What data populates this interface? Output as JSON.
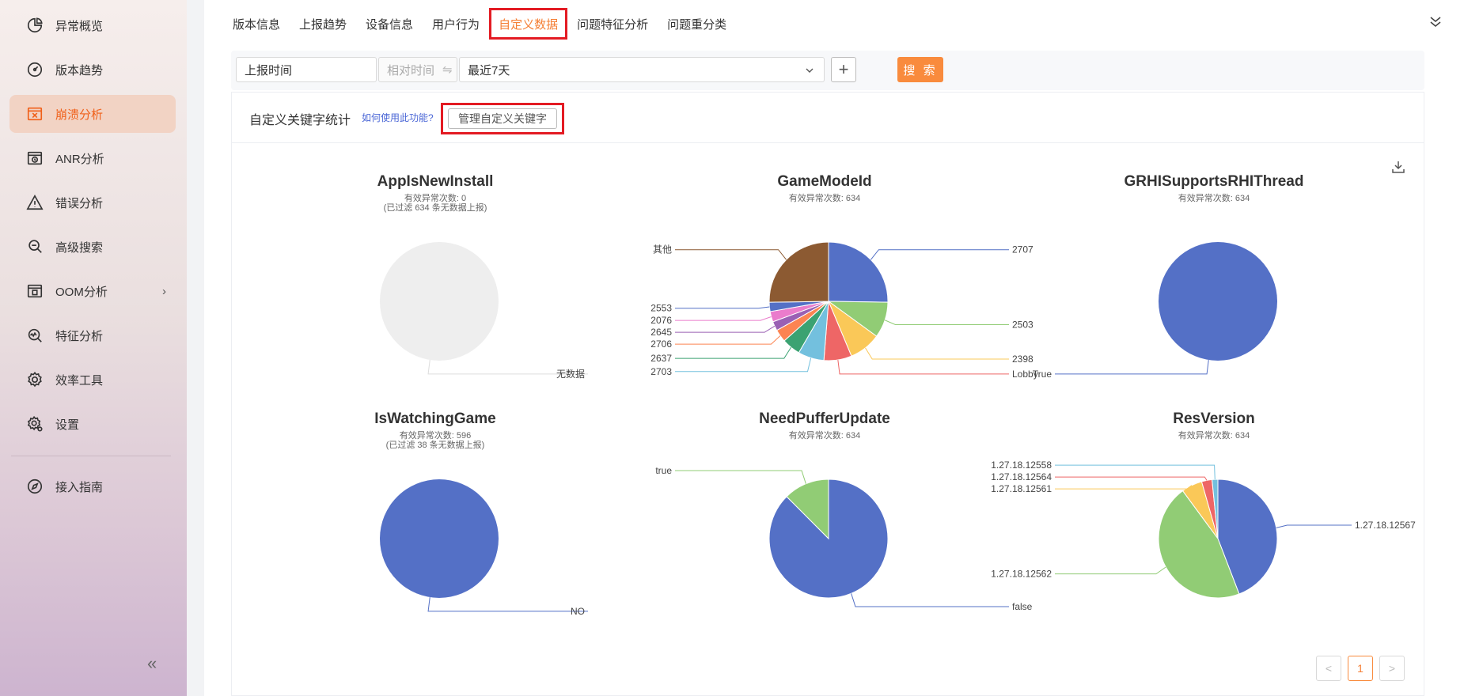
{
  "sidebar": {
    "items": [
      {
        "label": "异常概览",
        "icon": "pie-chart-icon"
      },
      {
        "label": "版本趋势",
        "icon": "gauge-icon"
      },
      {
        "label": "崩溃分析",
        "icon": "crash-window-icon"
      },
      {
        "label": "ANR分析",
        "icon": "anr-window-icon"
      },
      {
        "label": "错误分析",
        "icon": "warning-icon"
      },
      {
        "label": "高级搜索",
        "icon": "search-icon"
      },
      {
        "label": "OOM分析",
        "icon": "oom-window-icon"
      },
      {
        "label": "特征分析",
        "icon": "feature-search-icon"
      },
      {
        "label": "效率工具",
        "icon": "gear-icon"
      },
      {
        "label": "设置",
        "icon": "settings-icon"
      },
      {
        "label": "接入指南",
        "icon": "compass-icon"
      }
    ],
    "active_index": 2
  },
  "tabs": [
    "版本信息",
    "上报趋势",
    "设备信息",
    "用户行为",
    "自定义数据",
    "问题特征分析",
    "问题重分类"
  ],
  "active_tab_index": 4,
  "filter": {
    "field": "上报时间",
    "mode": "相对时间",
    "range": "最近7天",
    "search_label": "搜 索"
  },
  "panel": {
    "title": "自定义关键字统计",
    "help_link": "如何使用此功能?",
    "manage_button": "管理自定义关键字"
  },
  "chart_data": [
    {
      "type": "pie",
      "title": "AppIsNewInstall",
      "subtitle": "有效异常次数: 0",
      "note": "(已过滤 634 条无数据上报)",
      "slices": [
        {
          "label": "无数据",
          "value": 1,
          "color": "#eeeeee"
        }
      ]
    },
    {
      "type": "pie",
      "title": "GameModeId",
      "subtitle": "有效异常次数: 634",
      "slices": [
        {
          "label": "2707",
          "value": 160,
          "color": "#5470c6"
        },
        {
          "label": "2503",
          "value": 62,
          "color": "#91cc75"
        },
        {
          "label": "2398",
          "value": 55,
          "color": "#fac858"
        },
        {
          "label": "Lobby",
          "value": 48,
          "color": "#ee6666"
        },
        {
          "label": "2703",
          "value": 45,
          "color": "#73c0de"
        },
        {
          "label": "2637",
          "value": 32,
          "color": "#3ba272"
        },
        {
          "label": "2706",
          "value": 22,
          "color": "#fc8452"
        },
        {
          "label": "2645",
          "value": 16,
          "color": "#9a60b4"
        },
        {
          "label": "2076",
          "value": 18,
          "color": "#ea7ccc"
        },
        {
          "label": "2553",
          "value": 16,
          "color": "#5470c6"
        },
        {
          "label": "其他",
          "value": 160,
          "color": "#8c5a32"
        }
      ]
    },
    {
      "type": "pie",
      "title": "GRHISupportsRHIThread",
      "subtitle": "有效异常次数: 634",
      "slices": [
        {
          "label": "True",
          "value": 634,
          "color": "#5470c6"
        }
      ]
    },
    {
      "type": "pie",
      "title": "IsWatchingGame",
      "subtitle": "有效异常次数: 596",
      "note": "(已过滤 38 条无数据上报)",
      "slices": [
        {
          "label": "NO",
          "value": 596,
          "color": "#5470c6"
        }
      ]
    },
    {
      "type": "pie",
      "title": "NeedPufferUpdate",
      "subtitle": "有效异常次数: 634",
      "slices": [
        {
          "label": "false",
          "value": 555,
          "color": "#5470c6"
        },
        {
          "label": "true",
          "value": 79,
          "color": "#91cc75"
        }
      ]
    },
    {
      "type": "pie",
      "title": "ResVersion",
      "subtitle": "有效异常次数: 634",
      "slices": [
        {
          "label": "1.27.18.12567",
          "value": 280,
          "color": "#5470c6"
        },
        {
          "label": "1.27.18.12562",
          "value": 290,
          "color": "#91cc75"
        },
        {
          "label": "1.27.18.12561",
          "value": 36,
          "color": "#fac858"
        },
        {
          "label": "1.27.18.12564",
          "value": 18,
          "color": "#ee6666"
        },
        {
          "label": "1.27.18.12558",
          "value": 10,
          "color": "#73c0de"
        }
      ]
    }
  ],
  "pagination": {
    "prev": "<",
    "current": "1",
    "next": ">"
  }
}
